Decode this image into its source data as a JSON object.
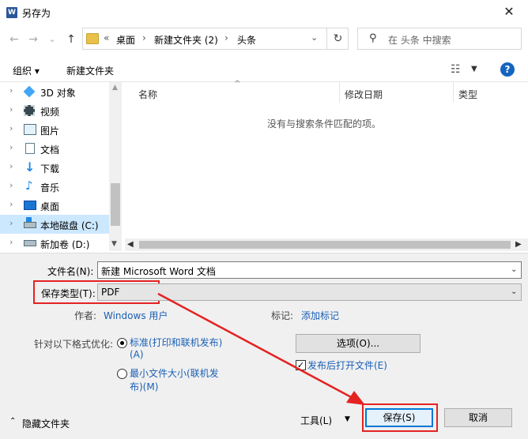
{
  "window": {
    "title": "另存为",
    "app_icon": "W",
    "close_glyph": "✕"
  },
  "nav": {
    "back_glyph": "←",
    "forward_glyph": "→",
    "recent_glyph": "⌄",
    "up_glyph": "↑",
    "breadcrumb_overflow": "«",
    "breadcrumbs": [
      "桌面",
      "新建文件夹 (2)",
      "头条"
    ],
    "separator": "›",
    "dropdown_glyph": "⌄",
    "refresh_glyph": "↻",
    "search_placeholder": "在 头条 中搜索",
    "search_glyph": "⚲"
  },
  "toolbar": {
    "organize": "组织 ▾",
    "new_folder": "新建文件夹",
    "view_glyph": "☷",
    "view_dropdown": "▼",
    "help": "?"
  },
  "sidebar": {
    "items": [
      {
        "label": "3D 对象",
        "icon": "cube-icon"
      },
      {
        "label": "视频",
        "icon": "video-icon"
      },
      {
        "label": "图片",
        "icon": "picture-icon"
      },
      {
        "label": "文档",
        "icon": "document-icon"
      },
      {
        "label": "下载",
        "icon": "download-icon"
      },
      {
        "label": "音乐",
        "icon": "music-icon"
      },
      {
        "label": "桌面",
        "icon": "desktop-icon"
      },
      {
        "label": "本地磁盘 (C:)",
        "icon": "drive-icon",
        "selected": true
      },
      {
        "label": "新加卷 (D:)",
        "icon": "drive-icon"
      }
    ],
    "arrow_glyph": "›"
  },
  "filelist": {
    "columns": [
      "名称",
      "修改日期",
      "类型"
    ],
    "empty_message": "没有与搜索条件匹配的项。"
  },
  "form": {
    "filename_label": "文件名(N):",
    "filename_value": "新建 Microsoft Word 文档",
    "filetype_label": "保存类型(T):",
    "filetype_value": "PDF",
    "author_label": "作者:",
    "author_value": "Windows 用户",
    "tags_label": "标记:",
    "tags_value": "添加标记",
    "optimize_label": "针对以下格式优化:",
    "option_standard_line1": "标准(打印和联机发布)",
    "option_standard_line2": "(A)",
    "option_min_line1": "最小文件大小(联机发",
    "option_min_line2": "布)(M)",
    "options_button": "选项(O)...",
    "open_after_publish": "发布后打开文件(E)",
    "open_after_publish_checked": true,
    "hide_folders": "隐藏文件夹",
    "tools": "工具(L)",
    "save": "保存(S)",
    "cancel": "取消"
  },
  "annotation": {
    "highlight_color": "#e52222"
  }
}
